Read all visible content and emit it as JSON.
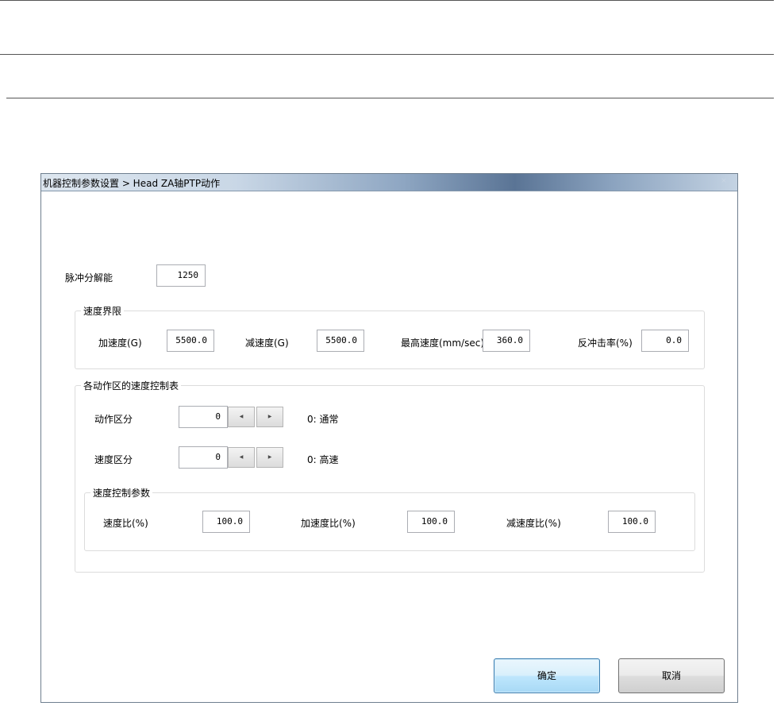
{
  "window": {
    "title": "机器控制参数设置 > Head ZA轴PTP动作",
    "close_glyph": "×"
  },
  "pulse_resolution": {
    "label": "脉冲分解能",
    "value": "1250"
  },
  "speed_limit": {
    "title": "速度界限",
    "accel": {
      "label": "加速度(G)",
      "value": "5500.0"
    },
    "decel": {
      "label": "减速度(G)",
      "value": "5500.0"
    },
    "max_speed": {
      "label": "最高速度(mm/sec)",
      "value": "360.0"
    },
    "recoil_rate": {
      "label": "反冲击率(%)",
      "value": "0.0"
    }
  },
  "speed_table": {
    "title": "各动作区的速度控制表",
    "action_section": {
      "label": "动作区分",
      "value": "0",
      "desc": "0: 通常"
    },
    "speed_section": {
      "label": "速度区分",
      "value": "0",
      "desc": "0: 高速"
    },
    "params": {
      "title": "速度控制参数",
      "speed_ratio": {
        "label": "速度比(%)",
        "value": "100.0"
      },
      "accel_ratio": {
        "label": "加速度比(%)",
        "value": "100.0"
      },
      "decel_ratio": {
        "label": "减速度比(%)",
        "value": "100.0"
      }
    }
  },
  "spin": {
    "left_glyph": "◀",
    "right_glyph": "▶"
  },
  "buttons": {
    "ok": "确定",
    "cancel": "取消"
  }
}
